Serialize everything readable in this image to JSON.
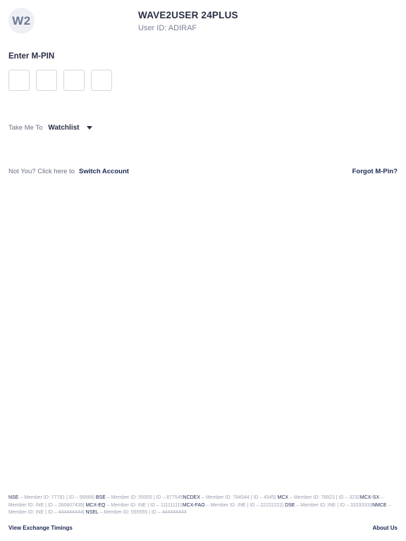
{
  "header": {
    "avatar_text": "W2",
    "user_name": "WAVE2USER 24PLUS",
    "user_id_text": "User ID: ADIRAF"
  },
  "mpin": {
    "title": "Enter M-PIN",
    "boxes": [
      "",
      "",
      "",
      ""
    ]
  },
  "take_me_to": {
    "label": "Take Me To",
    "selected": "Watchlist"
  },
  "account": {
    "not_you_text": "Not You? Click here to",
    "switch_label": "Switch Account",
    "forgot_label": "Forgot M-Pin?"
  },
  "disclaimer": [
    {
      "exchange": "NSE",
      "text": " – Member ID: 77781 | ID – 56666| "
    },
    {
      "exchange": "BSE",
      "text": " – Member ID: 55555 | ID – 877545"
    },
    {
      "exchange": "NCDEX",
      "text": " – Member ID: 784544 | ID – 4545| "
    },
    {
      "exchange": "MCX",
      "text": " – Member ID: 78923 | ID – 3232"
    },
    {
      "exchange": "MCX-SX",
      "text": " – Member ID: INE | ID – 260607435| "
    },
    {
      "exchange": "MCX-EQ",
      "text": " – Member ID: INE | ID – 111111111"
    },
    {
      "exchange": "MCX-FAO",
      "text": " – Member ID: INE | ID – 22222222| "
    },
    {
      "exchange": "DSE",
      "text": " – Member ID: INE | ID – 33333333"
    },
    {
      "exchange": "NMCE",
      "text": " – Member ID: INE | ID – 444444444| "
    },
    {
      "exchange": "NSEL",
      "text": " – Member ID: 555555 | ID – 444444444"
    }
  ],
  "footer": {
    "left_link": "View Exchange Timings",
    "right_link": "About Us"
  }
}
